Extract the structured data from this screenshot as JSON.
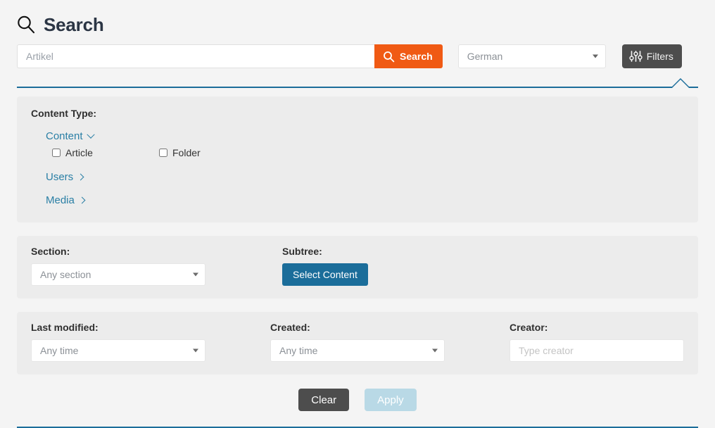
{
  "header": {
    "title": "Search",
    "icon": "search-icon"
  },
  "search_bar": {
    "query_value": "Artikel",
    "query_placeholder": "Artikel",
    "search_button_label": "Search",
    "search_button_icon": "search-icon",
    "search_button_color": "#f05a14",
    "language_selected": "German",
    "language_caret_icon": "chevron-down-icon",
    "filters_button_label": "Filters",
    "filters_button_icon": "sliders-icon",
    "filters_button_color": "#4d4d4d"
  },
  "accent_color": "#1b6d9a",
  "panel_background": "#ececec",
  "content_type": {
    "label": "Content Type:",
    "groups": [
      {
        "name": "Content",
        "expanded": true,
        "icon": "chevron-down-icon",
        "options": [
          {
            "label": "Article",
            "checked": false
          },
          {
            "label": "Folder",
            "checked": false
          }
        ]
      },
      {
        "name": "Users",
        "expanded": false,
        "icon": "chevron-right-icon",
        "options": []
      },
      {
        "name": "Media",
        "expanded": false,
        "icon": "chevron-right-icon",
        "options": []
      }
    ]
  },
  "section_panel": {
    "section_label": "Section:",
    "section_value": "Any section",
    "subtree_label": "Subtree:",
    "subtree_button_label": "Select Content",
    "subtree_button_color": "#1b6d9a"
  },
  "dates_panel": {
    "last_modified_label": "Last modified:",
    "last_modified_value": "Any time",
    "created_label": "Created:",
    "created_value": "Any time",
    "creator_label": "Creator:",
    "creator_value": "",
    "creator_placeholder": "Type creator"
  },
  "actions": {
    "clear_label": "Clear",
    "apply_label": "Apply",
    "clear_color": "#4d4d4d",
    "apply_color": "#b9d9e6"
  }
}
